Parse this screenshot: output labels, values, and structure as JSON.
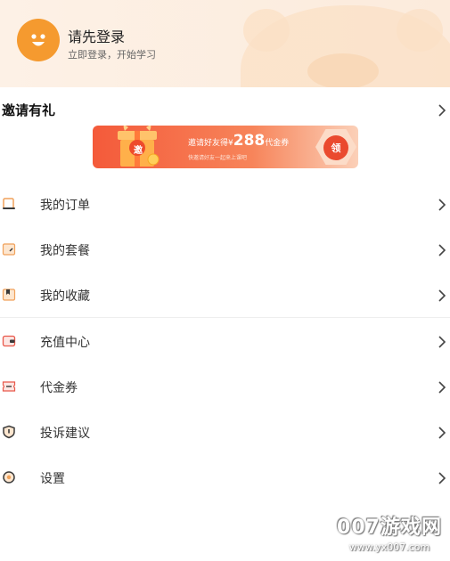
{
  "header": {
    "login_title": "请先登录",
    "login_subtitle": "立即登录，开始学习"
  },
  "invite": {
    "title": "邀请有礼",
    "banner": {
      "gift_char": "邀",
      "text_prefix": "邀请好友得¥",
      "amount": "288",
      "text_suffix": "代金券",
      "subtext": "快邀请好友一起来上课吧",
      "claim_label": "领"
    }
  },
  "menu": {
    "items": [
      {
        "label": "我的订单",
        "icon": "order-icon"
      },
      {
        "label": "我的套餐",
        "icon": "package-icon"
      },
      {
        "label": "我的收藏",
        "icon": "favorites-icon"
      },
      {
        "label": "充值中心",
        "icon": "wallet-icon"
      },
      {
        "label": "代金券",
        "icon": "coupon-icon"
      },
      {
        "label": "投诉建议",
        "icon": "feedback-shield-icon"
      },
      {
        "label": "设置",
        "icon": "settings-icon"
      }
    ]
  },
  "watermark": {
    "title": "007游戏网",
    "url": "www.yx007.com"
  },
  "colors": {
    "accent": "#f59a2f",
    "banner_red": "#f45a3a",
    "icon_orange": "#f0a15a",
    "icon_red": "#e8584a",
    "icon_dark": "#3a3a3a"
  }
}
